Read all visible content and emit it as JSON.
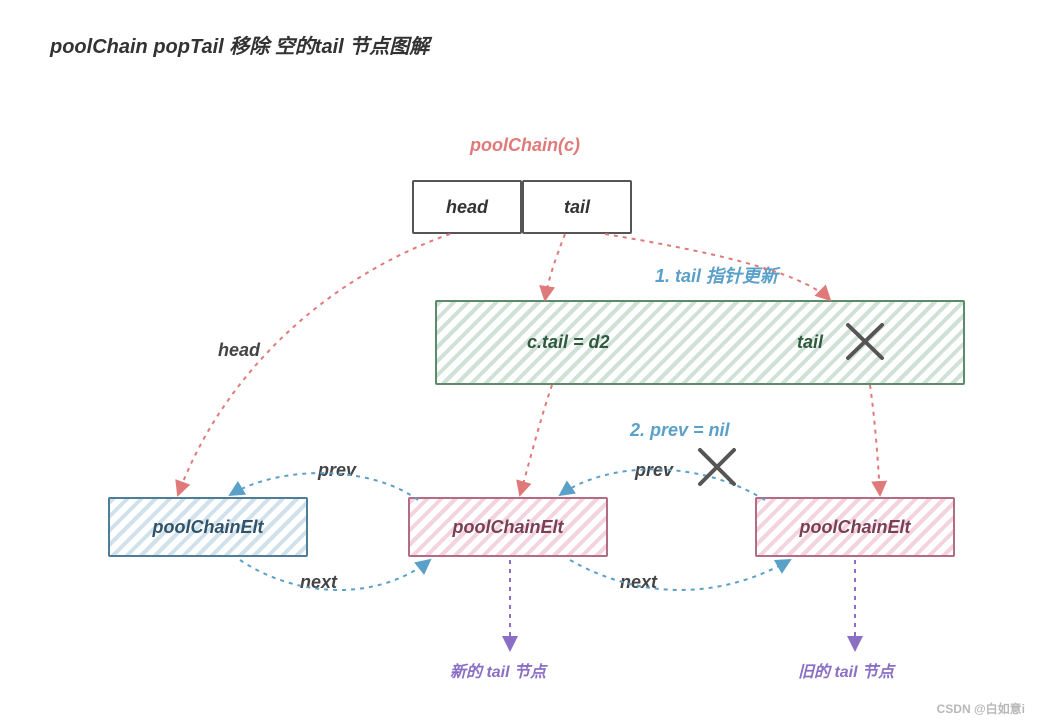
{
  "title": "poolChain popTail 移除 空的tail 节点图解",
  "watermark": "CSDN @白如意i",
  "top_label": "poolChain(c)",
  "struct_head": "head",
  "struct_tail": "tail",
  "step1": "1. tail 指针更新",
  "step2": "2. prev = nil",
  "green_left": "c.tail = d2",
  "green_right": "tail",
  "arrow_head": "head",
  "arrow_prev": "prev",
  "arrow_next": "next",
  "elt": "poolChainElt",
  "new_tail_note": "新的 tail 节点",
  "old_tail_note": "旧的 tail 节点"
}
